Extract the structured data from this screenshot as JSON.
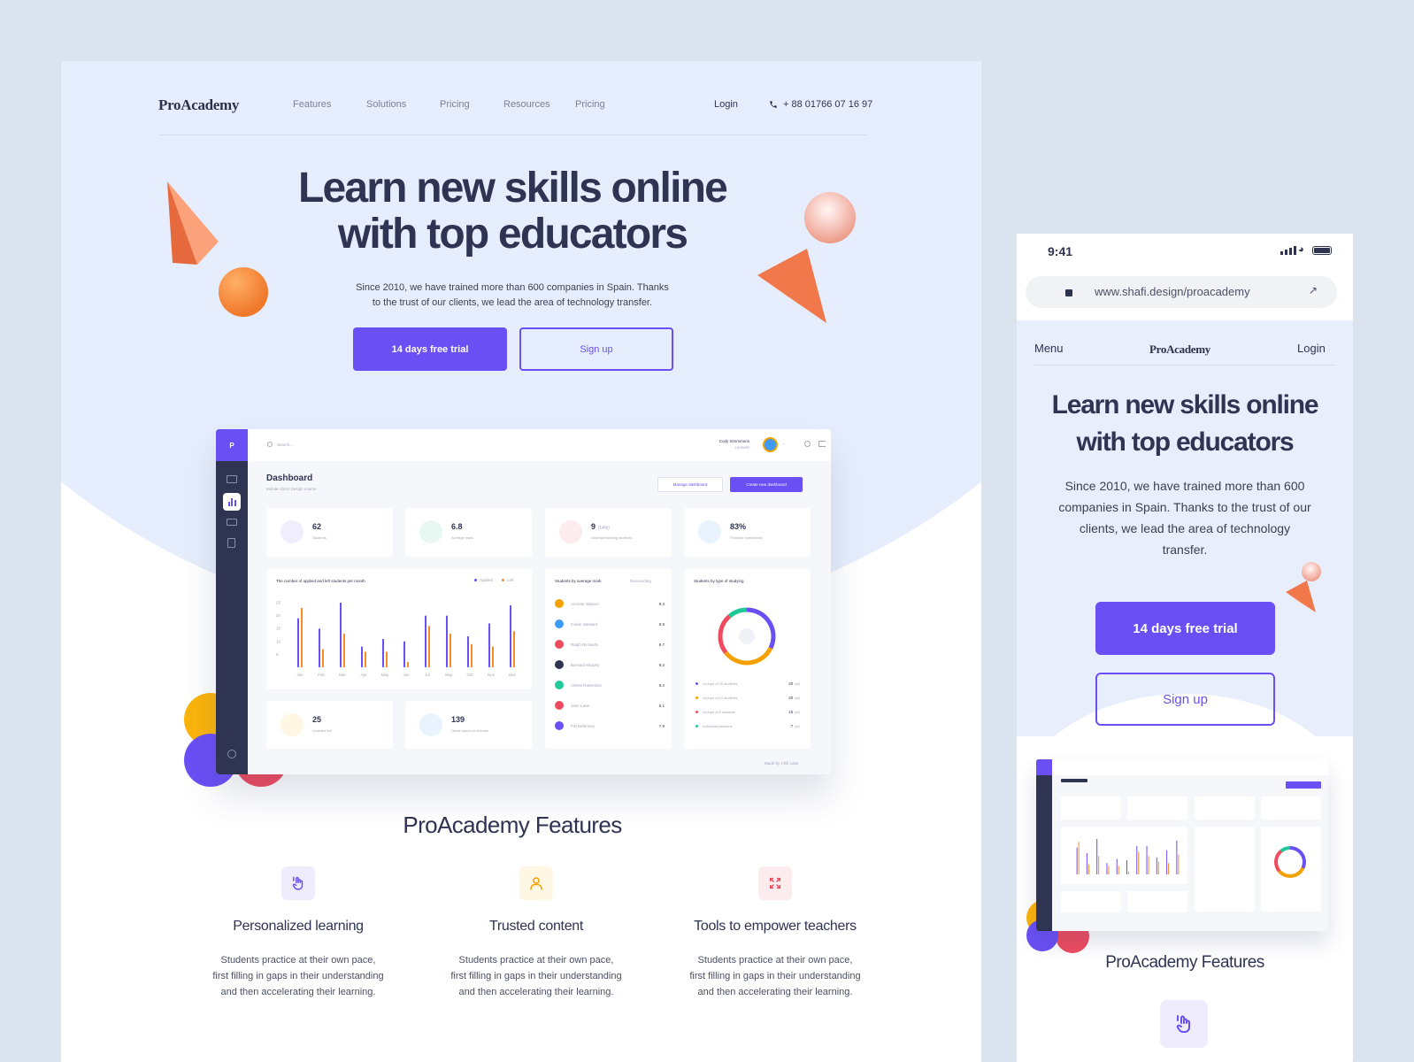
{
  "desktop": {
    "logo": "ProAcademy",
    "nav": [
      "Features",
      "Solutions",
      "Pricing",
      "Resources",
      "Pricing"
    ],
    "login": "Login",
    "phone": "+ 88 01766 07 16 97",
    "hero_title_1": "Learn new skills online",
    "hero_title_2": "with top educators",
    "hero_sub_1": "Since 2010, we have trained more than 600 companies in Spain. Thanks",
    "hero_sub_2": "to the trust of our clients, we lead the area of technology transfer.",
    "cta_primary": "14 days free trial",
    "cta_secondary": "Sign up",
    "features_title": "ProAcademy Features",
    "features": [
      {
        "title": "Personalized learning",
        "icon": "hand-tap-icon",
        "color": "#6a4ff5",
        "bg": "#efedfd",
        "l1": "Students practice at their own pace,",
        "l2": "first filling in gaps in their understanding",
        "l3": "and then accelerating their learning."
      },
      {
        "title": "Trusted content",
        "icon": "user-icon",
        "color": "#f4a100",
        "bg": "#fff6e4",
        "l1": "Students practice at their own pace,",
        "l2": "first filling in gaps in their understanding",
        "l3": "and then accelerating their learning."
      },
      {
        "title": "Tools to empower teachers",
        "icon": "expand-icon",
        "color": "#ef4b5f",
        "bg": "#fdecee",
        "l1": "Students practice at their own pace,",
        "l2": "first filling in gaps in their understanding",
        "l3": "and then accelerating their learning."
      }
    ]
  },
  "dashboard": {
    "logo": "P",
    "search": "Search...",
    "user": "Cody Simmmons",
    "user_role": "Lecturer",
    "title": "Dashboard",
    "subtitle": "Mobile UX/UI Design course",
    "manage_btn": "Manage dashboard",
    "create_btn": "Create new dashboard",
    "kpis": [
      {
        "value": "62",
        "label": "Students",
        "color": "#6a4ff5",
        "bg": "#f0edfd"
      },
      {
        "value": "6.8",
        "label": "Average mark",
        "color": "#20c997",
        "bg": "#e6f8f1"
      },
      {
        "value": "9",
        "extra": "(14%)",
        "label": "Underperforming students",
        "color": "#ef4b5f",
        "bg": "#fdecee"
      },
      {
        "value": "83%",
        "label": "Finished homeworks",
        "color": "#3d9bf5",
        "bg": "#e8f3fe"
      }
    ],
    "kpis2": [
      {
        "value": "25",
        "label": "Lectures left",
        "color": "#f4a100",
        "bg": "#fff6e4"
      },
      {
        "value": "139",
        "label": "Hours spent on lectures",
        "color": "#3d9bf5",
        "bg": "#e8f3fe"
      }
    ],
    "bar_chart_title": "The number of applied and left students per month",
    "legend_applied": "Applied",
    "legend_left": "Left",
    "avg_title": "Students by average mark",
    "avg_sort": "Descending",
    "students": [
      {
        "name": "Annette Watson",
        "mark": "9.3",
        "color": "#f4a100"
      },
      {
        "name": "Calvin Steward",
        "mark": "8.9",
        "color": "#3d9bf5"
      },
      {
        "name": "Ralph Richards",
        "mark": "8.7",
        "color": "#ef4b5f"
      },
      {
        "name": "Bernard Murphy",
        "mark": "8.2",
        "color": "#2f3452"
      },
      {
        "name": "Arlene Robertson",
        "mark": "8.2",
        "color": "#20c997"
      },
      {
        "name": "Jane Lane",
        "mark": "8.1",
        "color": "#ef4b5f"
      },
      {
        "name": "Pat Mckinney",
        "mark": "7.9",
        "color": "#6a4ff5"
      }
    ],
    "type_title": "Students by type of studying",
    "type_rows": [
      {
        "label": "Groups of 20 students",
        "value": "20",
        "unit": "(st)",
        "color": "#6a4ff5"
      },
      {
        "label": "Groups of 10 students",
        "value": "20",
        "unit": "(st)",
        "color": "#f4a100"
      },
      {
        "label": "Groups of 5 students",
        "value": "15",
        "unit": "(st)",
        "color": "#ef4b5f"
      },
      {
        "label": "Individual sessions",
        "value": "7",
        "unit": "(st)",
        "color": "#20c997"
      }
    ],
    "footer": "Made by Chili Labs",
    "chart_data": {
      "type": "bar",
      "title": "The number of applied and left students per month",
      "categories": [
        "Jan",
        "Feb",
        "Mar",
        "Apr",
        "May",
        "Jun",
        "Jul",
        "Sep",
        "Oct",
        "Nov",
        "Dec"
      ],
      "y_ticks": [
        "25",
        "20",
        "15",
        "10",
        "5"
      ],
      "ylim": [
        0,
        25
      ],
      "series": [
        {
          "name": "Applied",
          "color": "#6a4ff5",
          "values": [
            19,
            15,
            25,
            8,
            11,
            10,
            20,
            20,
            12,
            17,
            24
          ]
        },
        {
          "name": "Left",
          "color": "#f78b22",
          "values": [
            23,
            7,
            13,
            6,
            6,
            2,
            16,
            13,
            9,
            8,
            14
          ]
        }
      ]
    },
    "donut": [
      {
        "value": 20,
        "color": "#6a4ff5"
      },
      {
        "value": 20,
        "color": "#f4a100"
      },
      {
        "value": 15,
        "color": "#ef4b5f"
      },
      {
        "value": 7,
        "color": "#20c997"
      }
    ]
  },
  "mobile": {
    "time": "9:41",
    "url": "www.shafi.design/proacademy",
    "menu": "Menu",
    "logo": "ProAcademy",
    "login": "Login",
    "hero_title_1": "Learn new skills online",
    "hero_title_2": "with top educators",
    "hero_sub": [
      "Since 2010, we have trained more than 600",
      "companies in Spain. Thanks to the trust of our",
      "clients, we lead the area of technology",
      "transfer."
    ],
    "cta_primary": "14 days free trial",
    "cta_secondary": "Sign up",
    "features_title": "ProAcademy Features"
  }
}
